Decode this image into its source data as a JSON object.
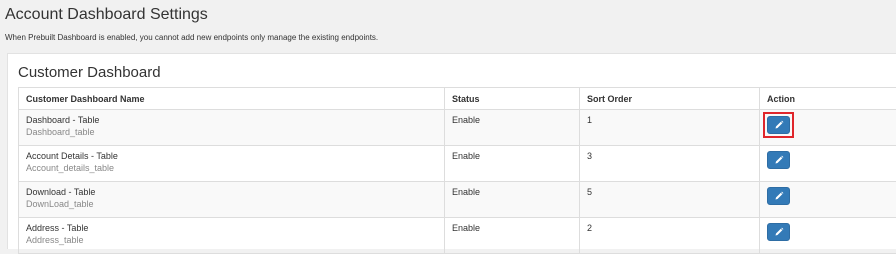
{
  "header": {
    "title": "Account Dashboard Settings",
    "subtitle": "When Prebuilt Dashboard is enabled, you cannot add new endpoints only manage the existing endpoints."
  },
  "card": {
    "title": "Customer Dashboard",
    "columns": [
      "Customer Dashboard Name",
      "Status",
      "Sort Order",
      "Action"
    ],
    "rows": [
      {
        "name": "Dashboard - Table",
        "table": "Dashboard_table",
        "status": "Enable",
        "sort": "1",
        "highlighted": true
      },
      {
        "name": "Account Details - Table",
        "table": "Account_details_table",
        "status": "Enable",
        "sort": "3",
        "highlighted": false
      },
      {
        "name": "Download - Table",
        "table": "DownLoad_table",
        "status": "Enable",
        "sort": "5",
        "highlighted": false
      },
      {
        "name": "Address - Table",
        "table": "Address_table",
        "status": "Enable",
        "sort": "2",
        "highlighted": false
      }
    ]
  },
  "colors": {
    "button": "#337ab7",
    "highlight": "#e0262b"
  },
  "icons": {
    "edit": "pencil-icon"
  }
}
